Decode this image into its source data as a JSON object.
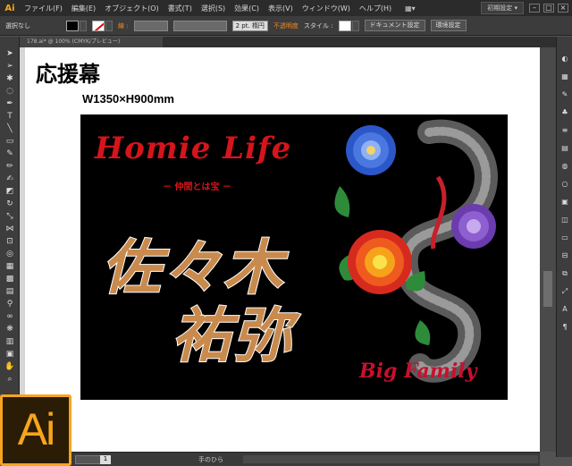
{
  "app": {
    "logo": "Ai",
    "workspace": "初期設定 ▾"
  },
  "menu": [
    "ファイル(F)",
    "編集(E)",
    "オブジェクト(O)",
    "書式(T)",
    "選択(S)",
    "効果(C)",
    "表示(V)",
    "ウィンドウ(W)",
    "ヘルプ(H)"
  ],
  "control": {
    "selection": "選択なし",
    "stroke_label": "線 :",
    "stroke_weight": "2 pt. 楕円",
    "opacity": "不透明度",
    "style_label": "スタイル :",
    "doc_settings": "ドキュメント設定",
    "prefs": "環境設定"
  },
  "tab": {
    "label": "178.ai* @ 100% (CMYK/プレビュー)"
  },
  "artboard": {
    "title": "応援幕",
    "size": "W1350×H900mm"
  },
  "banner": {
    "headline": "Homie Life",
    "subtitle": "－ 仲間とは宝 －",
    "name_line1": "佐々木",
    "name_line2": "祐弥",
    "footer": "Big Family"
  },
  "status": {
    "zoom": "100%",
    "page": "1",
    "tool": "手のひら"
  },
  "colors": {
    "accent": "#f7a51c",
    "banner_red": "#d6141b",
    "name_fill": "#c98a4d"
  }
}
